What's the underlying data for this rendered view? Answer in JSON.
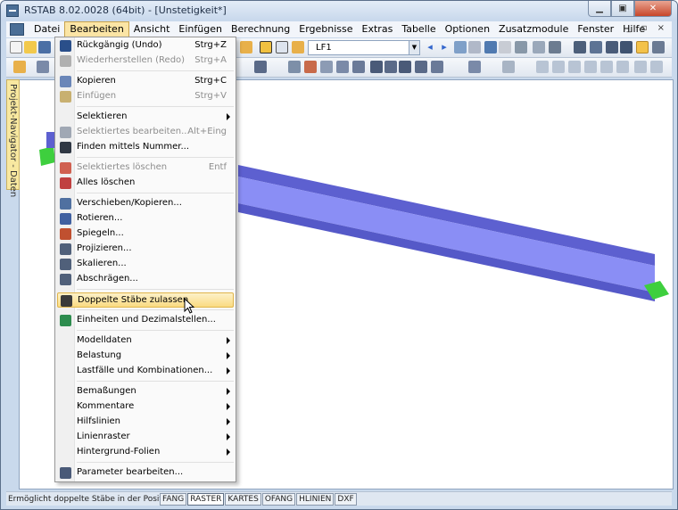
{
  "window": {
    "title": "RSTAB 8.02.0028 (64bit) - [Unstetigkeit*]",
    "min_icon": "minimize-icon",
    "max_icon": "maximize-icon",
    "close_icon": "close-icon"
  },
  "menubar": [
    "Datei",
    "Bearbeiten",
    "Ansicht",
    "Einfügen",
    "Berechnung",
    "Ergebnisse",
    "Extras",
    "Tabelle",
    "Optionen",
    "Zusatzmodule",
    "Fenster",
    "Hilfe"
  ],
  "toolbar": {
    "load_case_value": "LF1"
  },
  "navigator_tab": "Projekt-Navigator - Daten",
  "dropdown": {
    "items": [
      {
        "label": "Rückgängig (Undo)",
        "shortcut": "Strg+Z",
        "enabled": true,
        "icon": "undo-icon"
      },
      {
        "label": "Wiederherstellen (Redo)",
        "shortcut": "Strg+A",
        "enabled": false,
        "icon": "redo-icon"
      },
      {
        "label": "Kopieren",
        "shortcut": "Strg+C",
        "enabled": true,
        "icon": "copy-icon"
      },
      {
        "label": "Einfügen",
        "shortcut": "Strg+V",
        "enabled": false,
        "icon": "paste-icon"
      },
      {
        "label": "Selektieren",
        "shortcut": "",
        "enabled": true,
        "icon": "",
        "submenu": true
      },
      {
        "label": "Selektiertes bearbeiten...",
        "shortcut": "Alt+Eing",
        "enabled": false,
        "icon": "edit-icon"
      },
      {
        "label": "Finden mittels Nummer...",
        "shortcut": "",
        "enabled": true,
        "icon": "binoculars-icon"
      },
      {
        "label": "Selektiertes löschen",
        "shortcut": "Entf",
        "enabled": false,
        "icon": "delete-icon"
      },
      {
        "label": "Alles löschen",
        "shortcut": "",
        "enabled": true,
        "icon": "delete-all-icon"
      },
      {
        "label": "Verschieben/Kopieren...",
        "shortcut": "",
        "enabled": true,
        "icon": "move-icon"
      },
      {
        "label": "Rotieren...",
        "shortcut": "",
        "enabled": true,
        "icon": "rotate-icon"
      },
      {
        "label": "Spiegeln...",
        "shortcut": "",
        "enabled": true,
        "icon": "mirror-icon"
      },
      {
        "label": "Projizieren...",
        "shortcut": "",
        "enabled": true,
        "icon": "project-icon"
      },
      {
        "label": "Skalieren...",
        "shortcut": "",
        "enabled": true,
        "icon": "scale-icon"
      },
      {
        "label": "Abschrägen...",
        "shortcut": "",
        "enabled": true,
        "icon": "shear-icon"
      },
      {
        "label": "Doppelte Stäbe zulassen",
        "shortcut": "",
        "enabled": true,
        "icon": "pencil-icon",
        "highlighted": true
      },
      {
        "label": "Einheiten und Dezimalstellen...",
        "shortcut": "",
        "enabled": true,
        "icon": "units-icon"
      },
      {
        "label": "Modelldaten",
        "shortcut": "",
        "enabled": true,
        "icon": "",
        "submenu": true
      },
      {
        "label": "Belastung",
        "shortcut": "",
        "enabled": true,
        "icon": "",
        "submenu": true
      },
      {
        "label": "Lastfälle und Kombinationen...",
        "shortcut": "",
        "enabled": true,
        "icon": "",
        "submenu": true
      },
      {
        "label": "Bemaßungen",
        "shortcut": "",
        "enabled": true,
        "icon": "",
        "submenu": true
      },
      {
        "label": "Kommentare",
        "shortcut": "",
        "enabled": true,
        "icon": "",
        "submenu": true
      },
      {
        "label": "Hilfslinien",
        "shortcut": "",
        "enabled": true,
        "icon": "",
        "submenu": true
      },
      {
        "label": "Linienraster",
        "shortcut": "",
        "enabled": true,
        "icon": "",
        "submenu": true
      },
      {
        "label": "Hintergrund-Folien",
        "shortcut": "",
        "enabled": true,
        "icon": "",
        "submenu": true
      },
      {
        "label": "Parameter bearbeiten...",
        "shortcut": "",
        "enabled": true,
        "icon": "parameters-icon"
      }
    ]
  },
  "statusbar": {
    "text": "Ermöglicht doppelte Stäbe in der Position \\Dop",
    "buttons": [
      "FANG",
      "RASTER",
      "KARTES",
      "OFANG",
      "HLINIEN",
      "DXF"
    ]
  },
  "colors": {
    "beam": "#8a8ef5",
    "beam_dark": "#5559c8",
    "support": "#3ecf3e",
    "highlight": "#fadb82"
  }
}
